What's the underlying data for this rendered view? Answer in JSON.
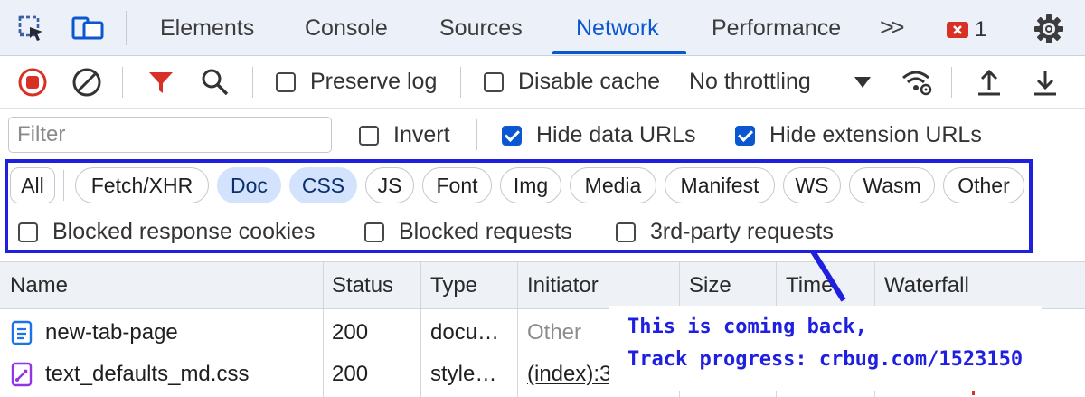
{
  "tabs": [
    {
      "label": "Elements"
    },
    {
      "label": "Console"
    },
    {
      "label": "Sources"
    },
    {
      "label": "Network"
    },
    {
      "label": "Performance"
    }
  ],
  "active_tab": "Network",
  "more_tabs": ">>",
  "error_count": "1",
  "toolbar": {
    "preserve_log": "Preserve log",
    "disable_cache": "Disable cache",
    "throttling": "No throttling"
  },
  "filter": {
    "placeholder": "Filter",
    "invert": "Invert",
    "hide_data_urls": "Hide data URLs",
    "hide_extension_urls": "Hide extension URLs"
  },
  "type_filters": [
    {
      "label": "All"
    },
    {
      "label": "Fetch/XHR"
    },
    {
      "label": "Doc"
    },
    {
      "label": "CSS"
    },
    {
      "label": "JS"
    },
    {
      "label": "Font"
    },
    {
      "label": "Img"
    },
    {
      "label": "Media"
    },
    {
      "label": "Manifest"
    },
    {
      "label": "WS"
    },
    {
      "label": "Wasm"
    },
    {
      "label": "Other"
    }
  ],
  "extra_filters": {
    "blocked_cookies": "Blocked response cookies",
    "blocked_requests": "Blocked requests",
    "third_party": "3rd-party requests"
  },
  "columns": [
    "Name",
    "Status",
    "Type",
    "Initiator",
    "Size",
    "Time",
    "Waterfall"
  ],
  "rows": [
    {
      "name": "new-tab-page",
      "status": "200",
      "type": "docu…",
      "initiator": "Other"
    },
    {
      "name": "text_defaults_md.css",
      "status": "200",
      "type": "style…",
      "initiator": "(index):3"
    }
  ],
  "annotation": {
    "line1": "This is coming back,",
    "line2": "Track progress: crbug.com/1523150"
  },
  "colors": {
    "accent": "#0b57d0",
    "annotation": "#1f1fe0",
    "record": "#d93025",
    "filter_icon": "#d93025"
  }
}
